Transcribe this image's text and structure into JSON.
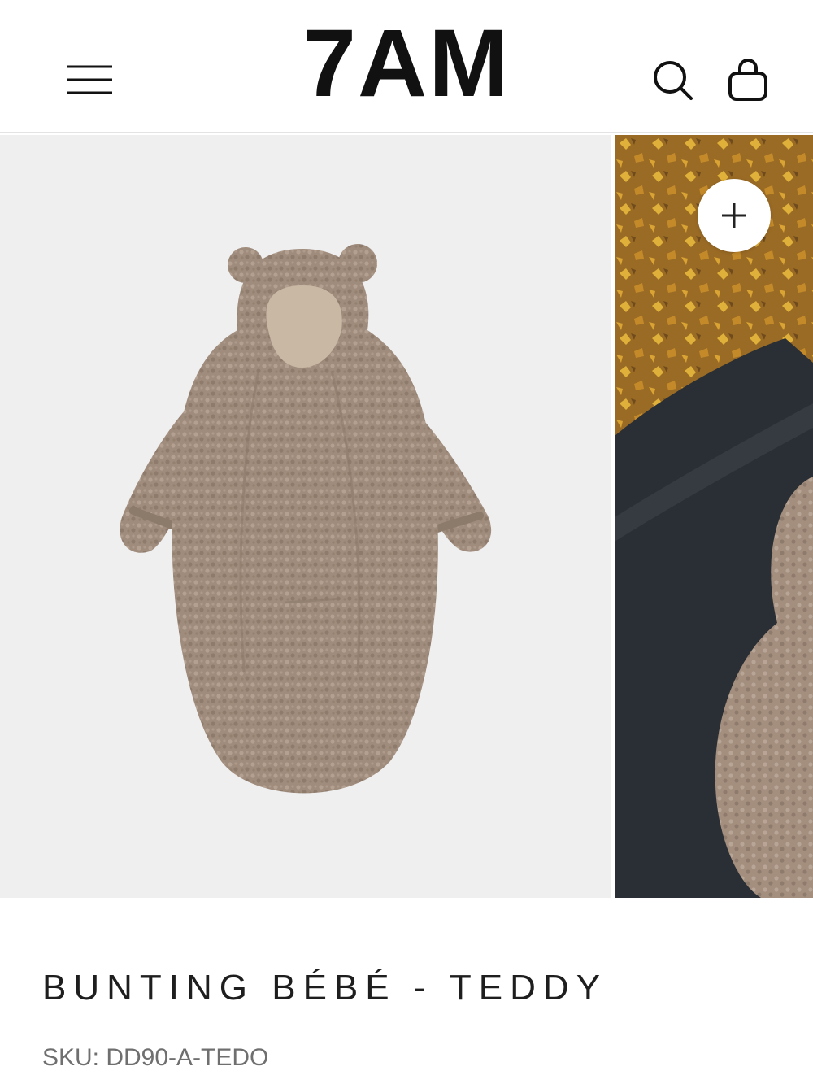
{
  "header": {
    "logo": "7AM",
    "menu_icon": "hamburger-menu-icon",
    "search_icon": "search-icon",
    "bag_icon": "shopping-bag-icon"
  },
  "gallery": {
    "images": [
      {
        "subject": "teddy bunting product photo",
        "background": "#efeff0"
      },
      {
        "subject": "lifestyle photo with autumn leaves",
        "background": "#b98a2e"
      }
    ],
    "zoom_icon": "plus-icon"
  },
  "product": {
    "title": "BUNTING BÉBÉ - TEDDY",
    "sku": "SKU: DD90-A-TEDO"
  },
  "colors": {
    "teddy": "#a08c7c",
    "lining": "#c9b8a4",
    "text_dark": "#1e1e1e",
    "text_muted": "#6f6f6f"
  }
}
